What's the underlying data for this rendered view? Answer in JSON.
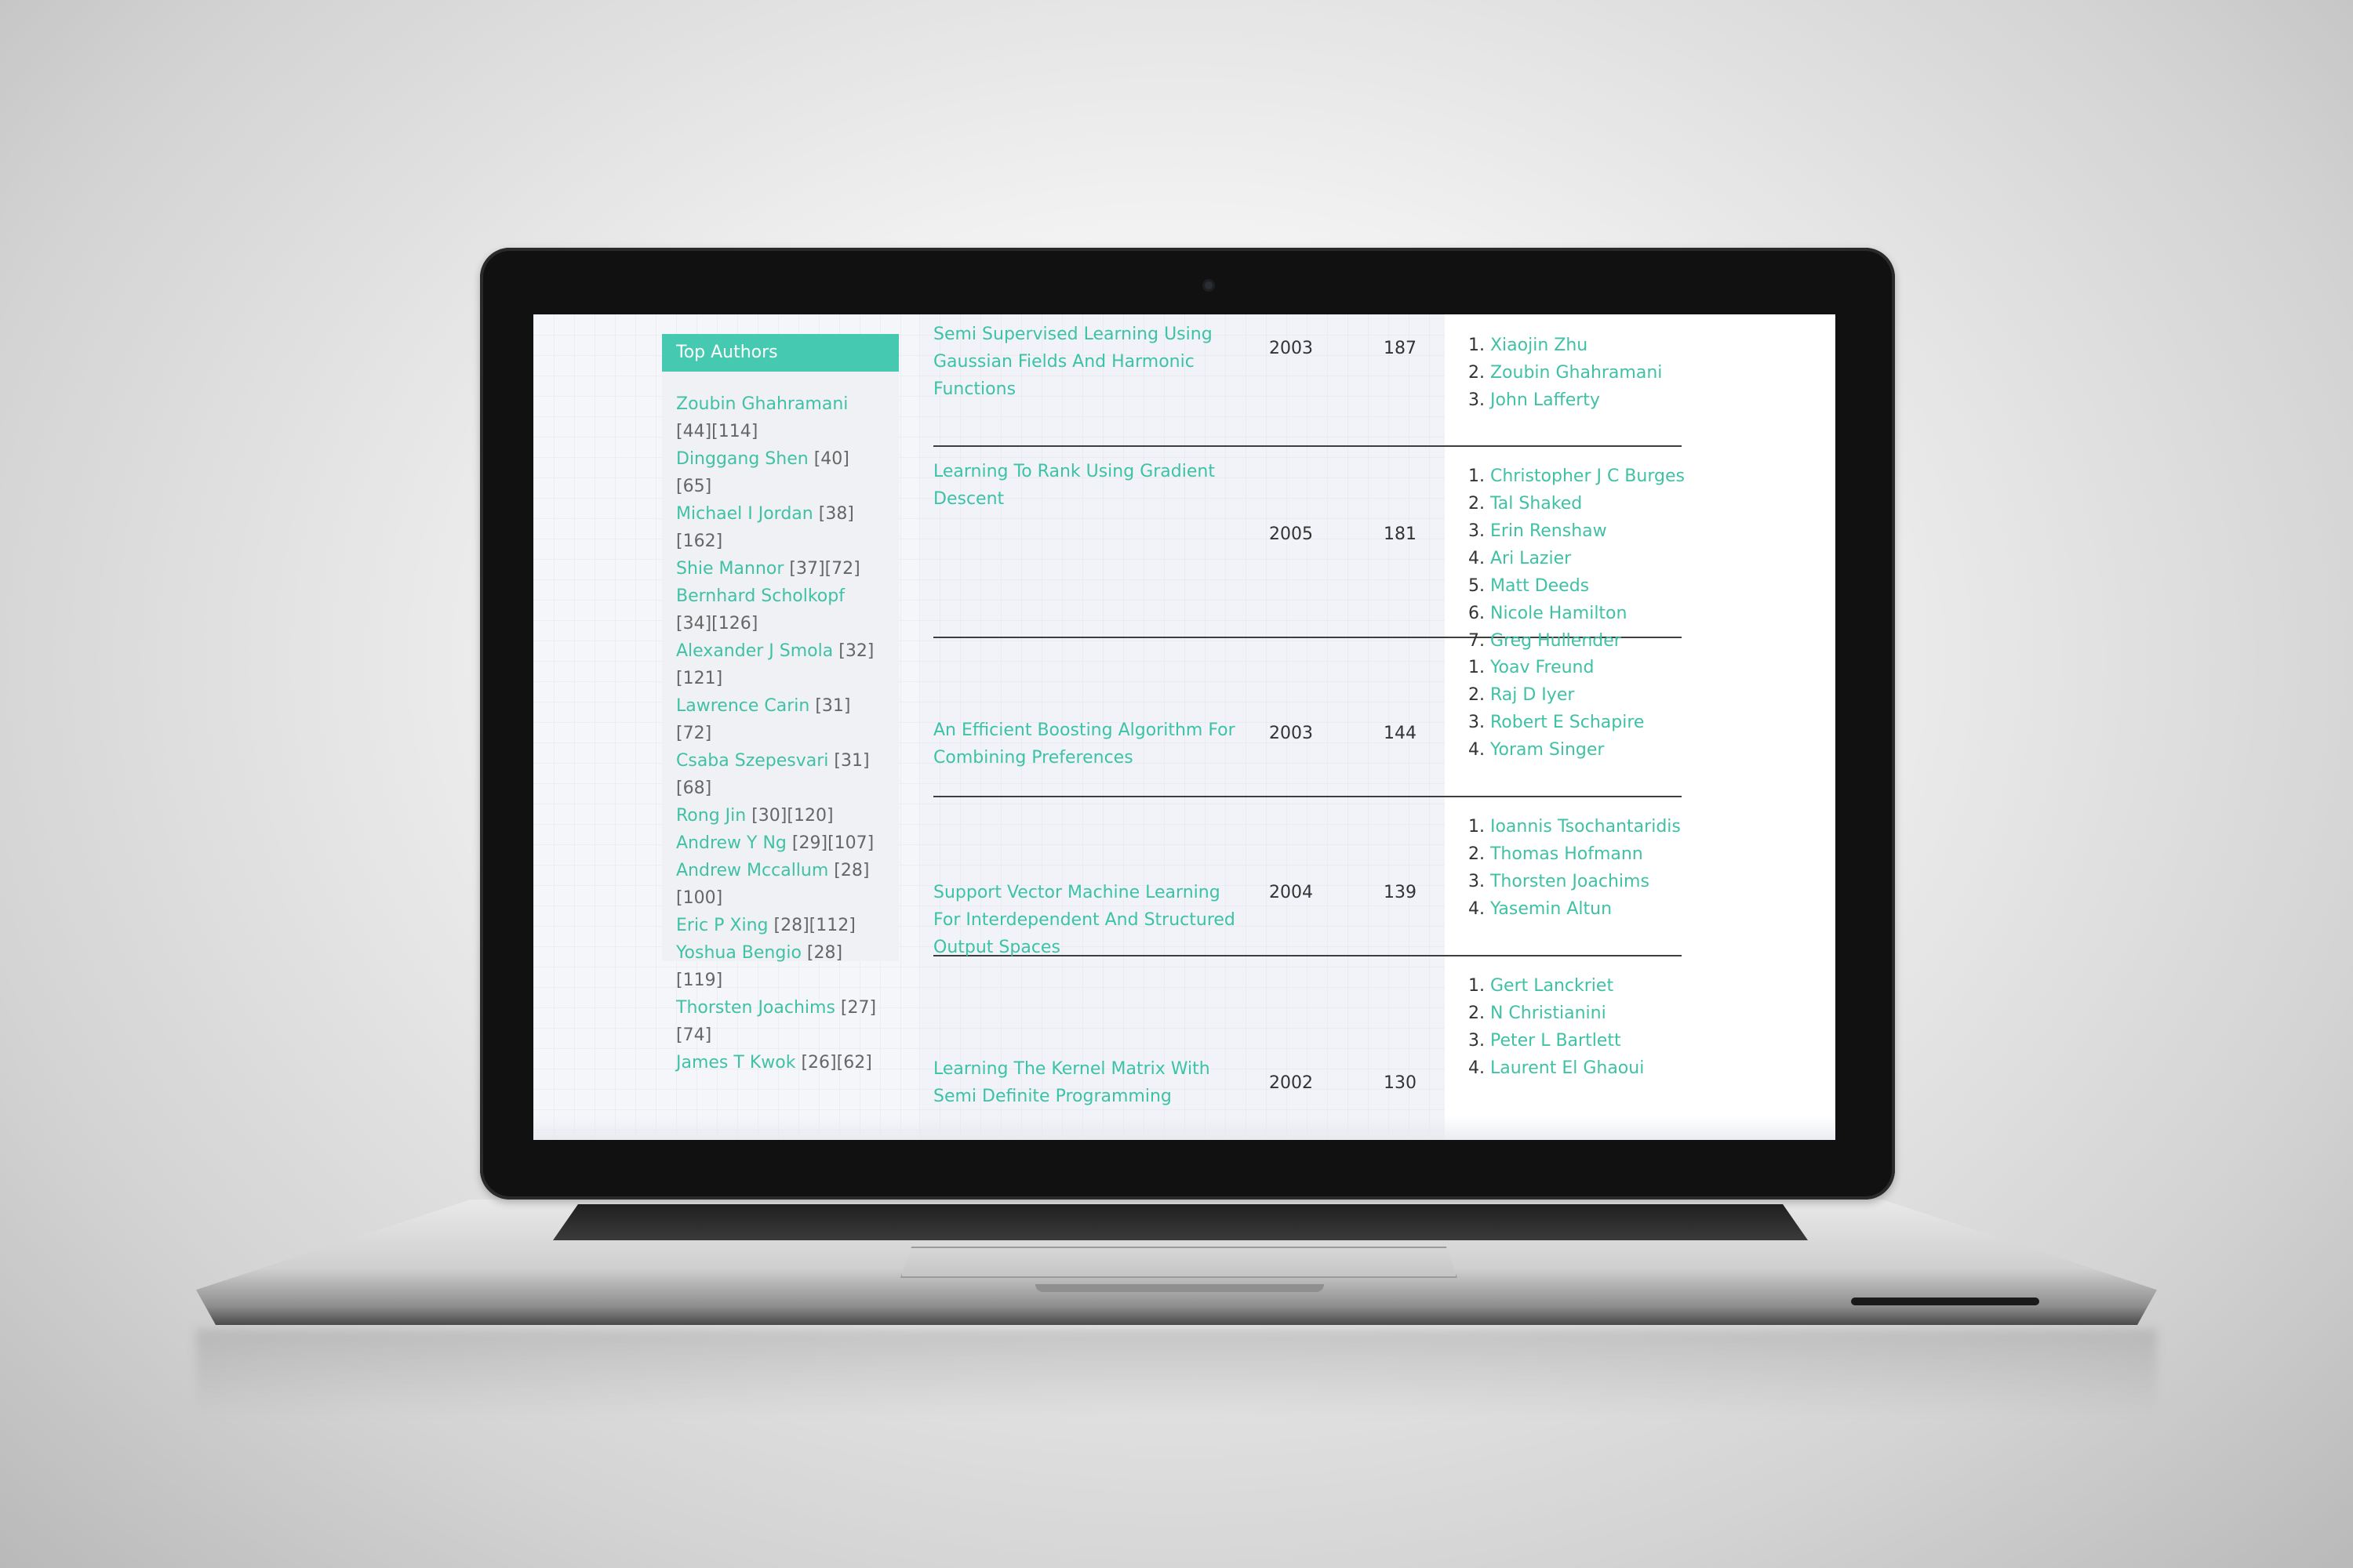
{
  "sidebar": {
    "title": "Top Authors",
    "authors": [
      {
        "name": "Zoubin Ghahramani",
        "stats": "[44][114]"
      },
      {
        "name": "Dinggang Shen",
        "stats": "[40][65]"
      },
      {
        "name": "Michael I Jordan",
        "stats": "[38][162]"
      },
      {
        "name": "Shie Mannor",
        "stats": "[37][72]"
      },
      {
        "name": "Bernhard Scholkopf",
        "stats": "[34][126]"
      },
      {
        "name": "Alexander J Smola",
        "stats": "[32][121]"
      },
      {
        "name": "Lawrence Carin",
        "stats": "[31][72]"
      },
      {
        "name": "Csaba Szepesvari",
        "stats": "[31][68]"
      },
      {
        "name": "Rong Jin",
        "stats": "[30][120]"
      },
      {
        "name": "Andrew Y Ng",
        "stats": "[29][107]"
      },
      {
        "name": "Andrew Mccallum",
        "stats": "[28][100]"
      },
      {
        "name": "Eric P Xing",
        "stats": "[28][112]"
      },
      {
        "name": "Yoshua Bengio",
        "stats": "[28][119]"
      },
      {
        "name": "Thorsten Joachims",
        "stats": "[27][74]"
      },
      {
        "name": "James T Kwok",
        "stats": "[26][62]"
      }
    ]
  },
  "papers": [
    {
      "title": "Semi Supervised Learning Using Gaussian Fields And Harmonic Functions",
      "year": "2003",
      "citations": "187",
      "authors": [
        "Xiaojin Zhu",
        "Zoubin Ghahramani",
        "John Lafferty"
      ]
    },
    {
      "title": "Learning To Rank Using Gradient Descent",
      "year": "2005",
      "citations": "181",
      "authors": [
        "Christopher J C Burges",
        "Tal Shaked",
        "Erin Renshaw",
        "Ari Lazier",
        "Matt Deeds",
        "Nicole Hamilton",
        "Greg Hullender"
      ]
    },
    {
      "title": "An Efficient Boosting Algorithm For Combining Preferences",
      "year": "2003",
      "citations": "144",
      "authors": [
        "Yoav Freund",
        "Raj D Iyer",
        "Robert E Schapire",
        "Yoram Singer"
      ]
    },
    {
      "title": "Support Vector Machine Learning For Interdependent And Structured Output Spaces",
      "year": "2004",
      "citations": "139",
      "authors": [
        "Ioannis Tsochantaridis",
        "Thomas Hofmann",
        "Thorsten Joachims",
        "Yasemin Altun"
      ]
    },
    {
      "title": "Learning The Kernel Matrix With Semi Definite Programming",
      "year": "2002",
      "citations": "130",
      "authors": [
        "Gert Lanckriet",
        "N Christianini",
        "Peter L Bartlett",
        "Laurent El Ghaoui"
      ]
    }
  ],
  "colors": {
    "accent": "#45c9b0",
    "link": "#40c1a6",
    "text": "#333333"
  }
}
